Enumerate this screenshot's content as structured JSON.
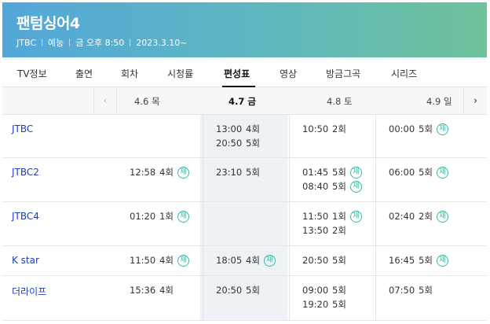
{
  "header": {
    "title": "팬텀싱어4",
    "meta": [
      "JTBC",
      "예능",
      "금 오후 8:50",
      "2023.3.10~"
    ]
  },
  "tabs": [
    "TV정보",
    "출연",
    "회차",
    "시청률",
    "편성표",
    "영상",
    "방금그곡",
    "시리즈"
  ],
  "active_tab": "편성표",
  "nav": {
    "prev": "‹",
    "next": "›"
  },
  "dates": [
    "4.6 목",
    "4.7 금",
    "4.8 토",
    "4.9 일"
  ],
  "today_date": "4.7 금",
  "rerun_mark": "재",
  "schedule": [
    {
      "channel": "JTBC",
      "cells": [
        [],
        [
          {
            "time": "13:00",
            "ep": "4회",
            "re": false
          },
          {
            "time": "20:50",
            "ep": "5회",
            "re": false
          }
        ],
        [
          {
            "time": "10:50",
            "ep": "2회",
            "re": false
          }
        ],
        [
          {
            "time": "00:00",
            "ep": "5회",
            "re": true
          }
        ]
      ]
    },
    {
      "channel": "JTBC2",
      "cells": [
        [
          {
            "time": "12:58",
            "ep": "4회",
            "re": true
          }
        ],
        [
          {
            "time": "23:10",
            "ep": "5회",
            "re": false
          }
        ],
        [
          {
            "time": "01:45",
            "ep": "5회",
            "re": true
          },
          {
            "time": "08:40",
            "ep": "5회",
            "re": true
          }
        ],
        [
          {
            "time": "06:00",
            "ep": "5회",
            "re": true
          }
        ]
      ]
    },
    {
      "channel": "JTBC4",
      "cells": [
        [
          {
            "time": "01:20",
            "ep": "1회",
            "re": true
          }
        ],
        [],
        [
          {
            "time": "11:50",
            "ep": "1회",
            "re": true
          },
          {
            "time": "13:50",
            "ep": "2회",
            "re": false
          }
        ],
        [
          {
            "time": "02:40",
            "ep": "2회",
            "re": true
          }
        ]
      ]
    },
    {
      "channel": "K star",
      "cells": [
        [
          {
            "time": "11:50",
            "ep": "4회",
            "re": true
          }
        ],
        [
          {
            "time": "18:05",
            "ep": "4회",
            "re": true
          }
        ],
        [
          {
            "time": "20:50",
            "ep": "5회",
            "re": false
          }
        ],
        [
          {
            "time": "16:45",
            "ep": "5회",
            "re": true
          }
        ]
      ]
    },
    {
      "channel": "더라이프",
      "cells": [
        [
          {
            "time": "15:36",
            "ep": "4회",
            "re": false
          }
        ],
        [
          {
            "time": "20:50",
            "ep": "5회",
            "re": false
          }
        ],
        [
          {
            "time": "09:00",
            "ep": "5회",
            "re": false
          },
          {
            "time": "19:20",
            "ep": "5회",
            "re": false
          }
        ],
        [
          {
            "time": "07:50",
            "ep": "5회",
            "re": false
          }
        ]
      ]
    }
  ]
}
